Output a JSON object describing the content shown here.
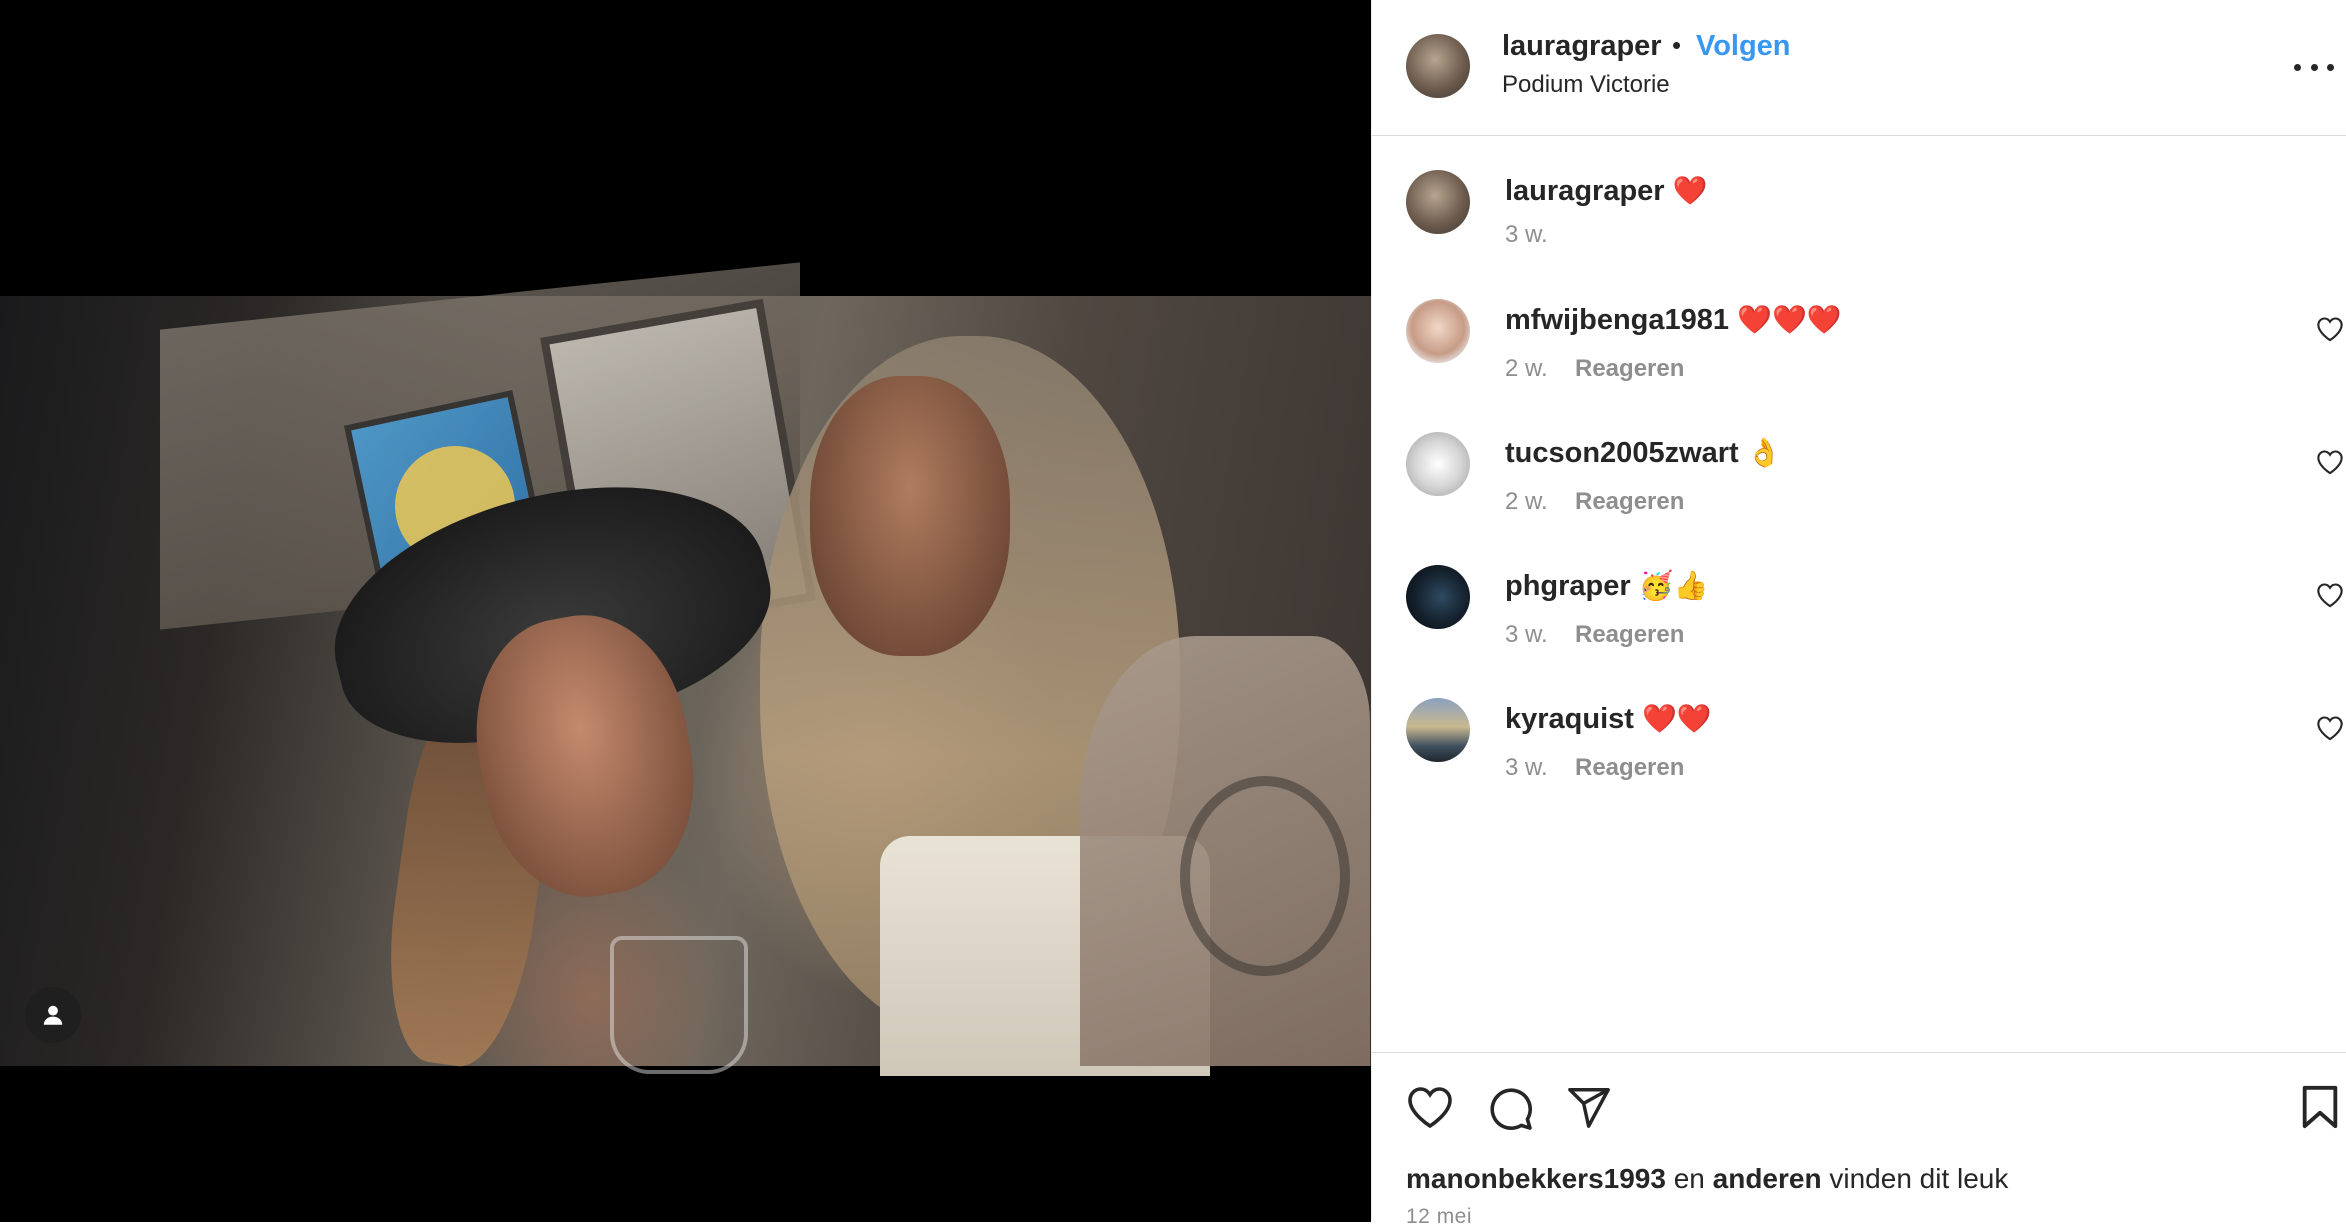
{
  "post": {
    "author": "lauragraper",
    "separator": "•",
    "follow_label": "Volgen",
    "location": "Podium Victorie",
    "more_icon": "more-horizontal-icon"
  },
  "comments": [
    {
      "user": "lauragraper",
      "text": "❤️",
      "time": "3 w.",
      "reply": ""
    },
    {
      "user": "mfwijbenga1981",
      "text": "❤️❤️❤️",
      "time": "2 w.",
      "reply": "Reageren"
    },
    {
      "user": "tucson2005zwart",
      "text": "👌",
      "time": "2 w.",
      "reply": "Reageren"
    },
    {
      "user": "phgraper",
      "text": "🥳👍",
      "time": "3 w.",
      "reply": "Reageren"
    },
    {
      "user": "kyraquist",
      "text": "❤️❤️",
      "time": "3 w.",
      "reply": "Reageren"
    }
  ],
  "likes": {
    "user": "manonbekkers1993",
    "conj": "en",
    "others": "anderen",
    "suffix": "vinden dit leuk"
  },
  "date": "12 mei",
  "colors": {
    "accent": "#3897f0",
    "text": "#262626",
    "muted": "#8e8e8e",
    "border": "#dbdbdb"
  }
}
